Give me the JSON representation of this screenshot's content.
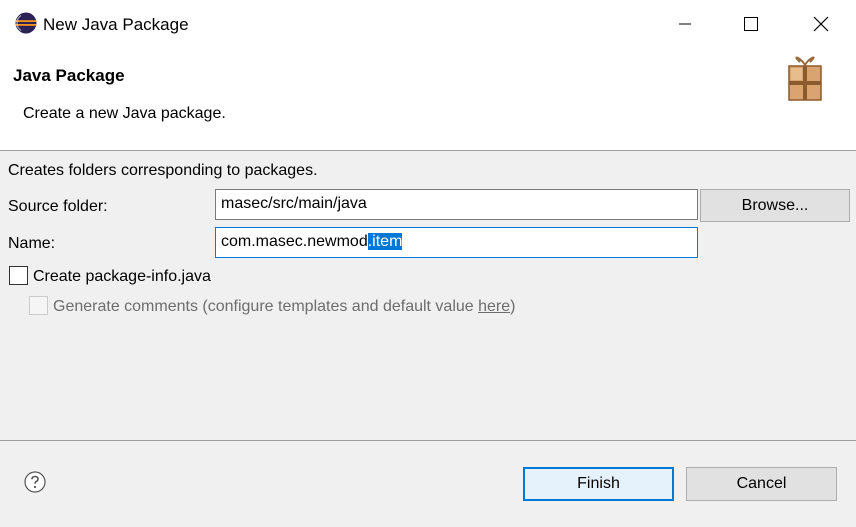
{
  "window": {
    "title": "New Java Package"
  },
  "header": {
    "title": "Java Package",
    "description": "Create a new Java package."
  },
  "form": {
    "intro": "Creates folders corresponding to packages.",
    "source_folder_label": "Source folder:",
    "source_folder_value": "masec/src/main/java",
    "browse_label": "Browse...",
    "name_label": "Name:",
    "name_value_prefix": "com.masec.newmod",
    "name_value_selected": ".item",
    "create_package_info_label": "Create package-info.java",
    "create_package_info_checked": false,
    "generate_comments_prefix": "Generate comments (configure templates and default value ",
    "generate_comments_link": "here",
    "generate_comments_suffix": ")",
    "generate_comments_enabled": false
  },
  "footer": {
    "finish_label": "Finish",
    "cancel_label": "Cancel"
  },
  "colors": {
    "accent": "#0078d7",
    "dialog_background": "#f0f0f0"
  },
  "icons": {
    "app": "eclipse-icon",
    "wizard": "package-icon",
    "help": "help-icon"
  }
}
